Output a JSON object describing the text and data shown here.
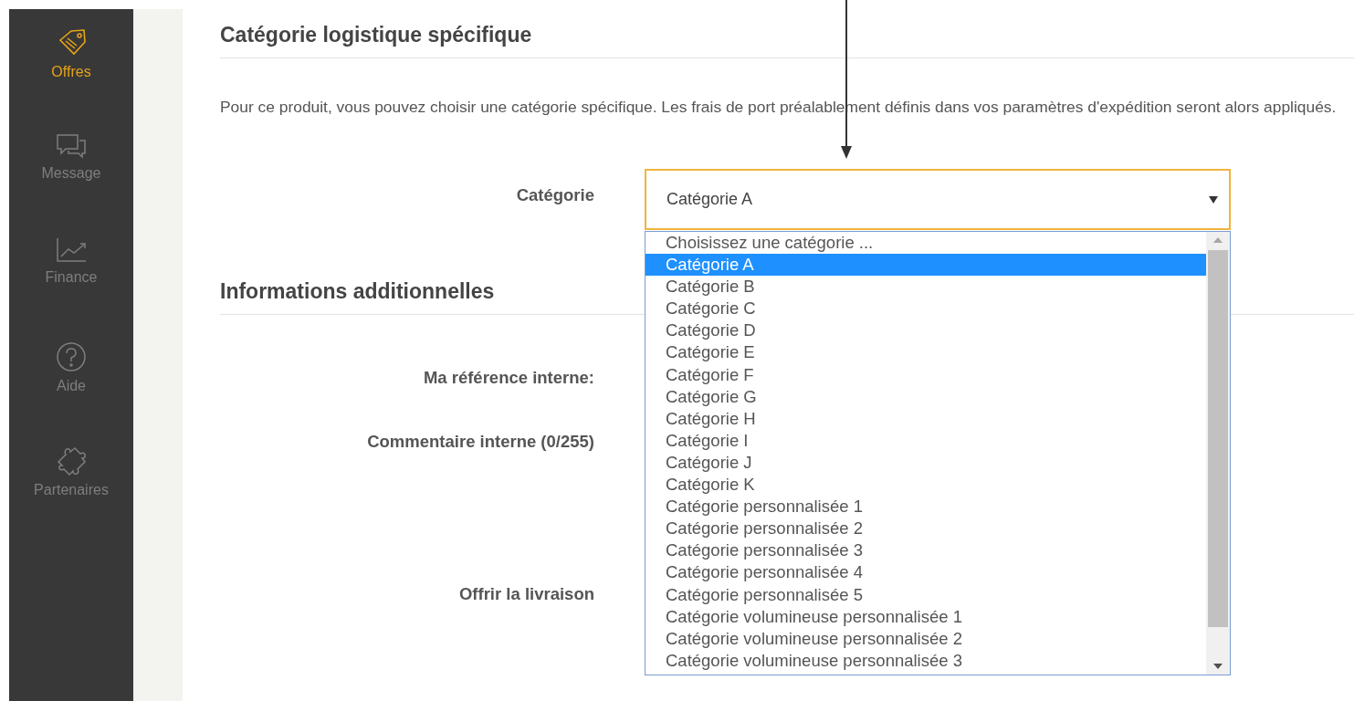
{
  "sidebar": {
    "items": [
      {
        "label": "Offres",
        "selected": true
      },
      {
        "label": "Message",
        "selected": false
      },
      {
        "label": "Finance",
        "selected": false
      },
      {
        "label": "Aide",
        "selected": false
      },
      {
        "label": "Partenaires",
        "selected": false
      }
    ]
  },
  "section_logistics": {
    "title": "Catégorie logistique spécifique",
    "description": "Pour ce produit, vous pouvez choisir une catégorie spécifique. Les frais de port préalablement définis dans vos paramètres d'expédition seront alors appliqués.",
    "field_label": "Catégorie",
    "select": {
      "value": "Catégorie A",
      "expanded": true,
      "options": [
        {
          "label": "Choisissez une catégorie ...",
          "selected": false
        },
        {
          "label": "Catégorie A",
          "selected": true
        },
        {
          "label": "Catégorie B",
          "selected": false
        },
        {
          "label": "Catégorie C",
          "selected": false
        },
        {
          "label": "Catégorie D",
          "selected": false
        },
        {
          "label": "Catégorie E",
          "selected": false
        },
        {
          "label": "Catégorie F",
          "selected": false
        },
        {
          "label": "Catégorie G",
          "selected": false
        },
        {
          "label": "Catégorie H",
          "selected": false
        },
        {
          "label": "Catégorie I",
          "selected": false
        },
        {
          "label": "Catégorie J",
          "selected": false
        },
        {
          "label": "Catégorie K",
          "selected": false
        },
        {
          "label": "Catégorie personnalisée 1",
          "selected": false
        },
        {
          "label": "Catégorie personnalisée 2",
          "selected": false
        },
        {
          "label": "Catégorie personnalisée 3",
          "selected": false
        },
        {
          "label": "Catégorie personnalisée 4",
          "selected": false
        },
        {
          "label": "Catégorie personnalisée 5",
          "selected": false
        },
        {
          "label": "Catégorie volumineuse personnalisée 1",
          "selected": false
        },
        {
          "label": "Catégorie volumineuse personnalisée 2",
          "selected": false
        },
        {
          "label": "Catégorie volumineuse personnalisée 3",
          "selected": false
        }
      ]
    }
  },
  "section_additional": {
    "title": "Informations additionnelles",
    "fields": [
      {
        "label": "Ma référence interne:"
      },
      {
        "label": "Commentaire interne (0/255)"
      },
      {
        "label": "Offrir la livraison"
      }
    ]
  }
}
